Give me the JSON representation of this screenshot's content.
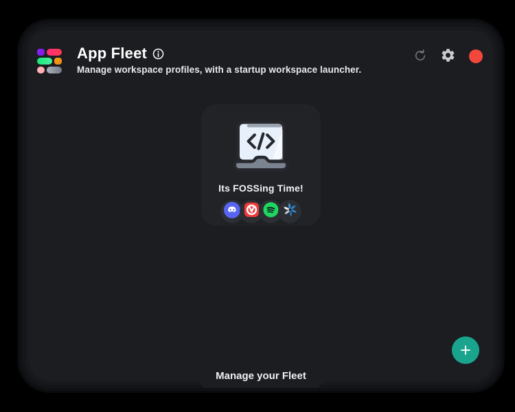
{
  "window": {
    "title": "App Fleet",
    "subtitle": "Manage workspace profiles, with a startup workspace launcher.",
    "header_icons": {
      "logo": "app-fleet-logo",
      "info": "info-icon",
      "refresh": "refresh-icon",
      "settings": "gear-icon",
      "record": "red-record-button"
    }
  },
  "workspace_card": {
    "name": "Its FOSSing Time!",
    "illustration": "laptop-code-illustration",
    "apps": [
      {
        "name": "discord",
        "color": "#5865F2"
      },
      {
        "name": "vivaldi",
        "color": "#EF3A3A"
      },
      {
        "name": "spotify",
        "color": "#1ED760"
      },
      {
        "name": "shutter",
        "color": "#2F82C9"
      }
    ]
  },
  "fab": {
    "label": "+"
  },
  "footer": {
    "label": "Manage your Fleet"
  },
  "colors": {
    "page_background": "#000000",
    "window_background": "#1b1d21",
    "card_background": "#212327",
    "accent_teal": "#1AA48E",
    "record_red": "#F2483C"
  }
}
